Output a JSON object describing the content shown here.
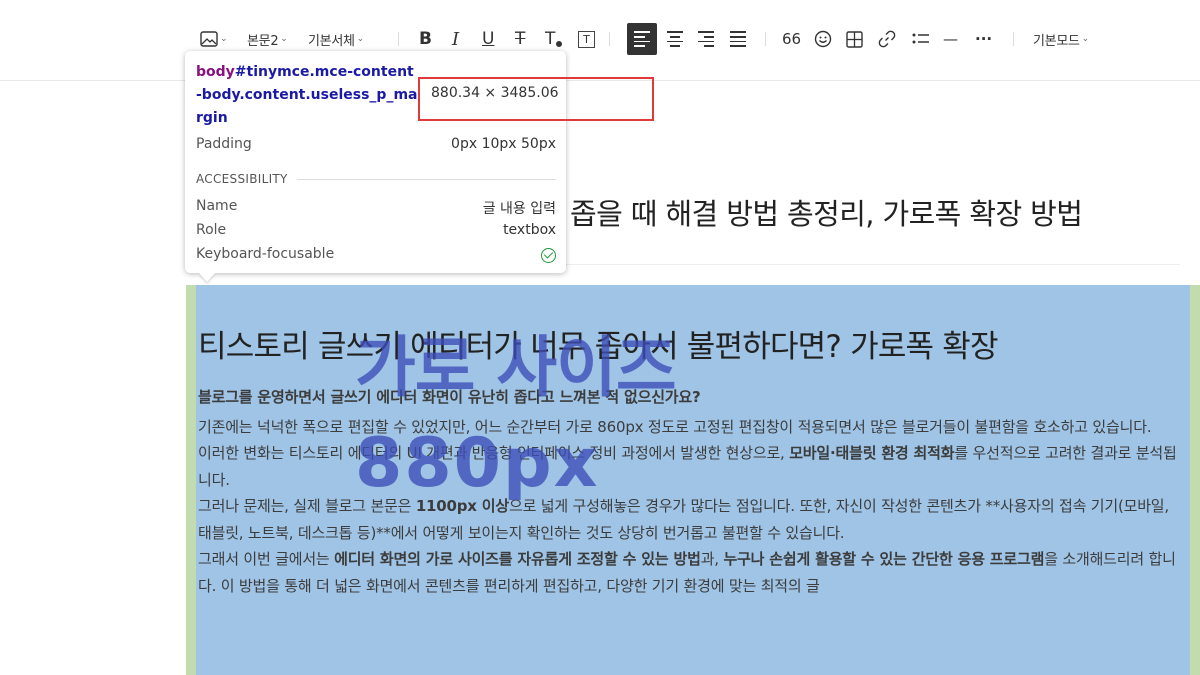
{
  "toolbar": {
    "image_icon": "image-icon",
    "paragraph_style": "본문2",
    "font_family": "기본서체",
    "bold": "B",
    "italic": "I",
    "underline": "U",
    "strike": "T",
    "text_color": "T",
    "text_bg": "T",
    "quote": "66",
    "emoji_icon": "emoji-icon",
    "table_icon": "table-icon",
    "link_icon": "link-icon",
    "list_icon": "list-icon",
    "divider": "—",
    "more": "···",
    "mode": "기본모드"
  },
  "post": {
    "title": "좁을 때 해결 방법 총정리, 가로폭 확장 방법",
    "heading": "티스토리 글쓰기 에디터가 너무 좁아서 불편하다면? 가로폭 확장",
    "lead": "블로그를 운영하면서 글쓰기 에디터 화면이 유난히 좁다고 느껴본 적 없으신가요?",
    "p1": "기존에는 넉넉한 폭으로 편집할 수 있었지만, 어느 순간부터 가로 860px 정도로 고정된 편집창이 적용되면서 많은 블로거들이 불편함을 호소하고 있습니다.",
    "p2_a": "이러한 변화는 티스토리 에디터의 UI 개편과 반응형 인터페이스 정비 과정에서 발생한 현상으로, ",
    "p2_b": "모바일·태블릿 환경 최적화",
    "p2_c": "를 우선적으로 고려한 결과로 분석됩니다.",
    "p3_a": "그러나 문제는, 실제 블로그 본문은 ",
    "p3_b": "1100px 이상",
    "p3_c": "으로 넓게 구성해놓은 경우가 많다는 점입니다. 또한, 자신이 작성한 콘텐츠가 **사용자의 접속 기기(모바일, 태블릿, 노트북, 데스크톱 등)**에서 어떻게 보이는지 확인하는 것도 상당히 번거롭고 불편할 수 있습니다.",
    "p4_a": "그래서 이번 글에서는 ",
    "p4_b": "에디터 화면의 가로 사이즈를 자유롭게 조정할 수 있는 방법",
    "p4_c": "과, ",
    "p4_d": "누구나 손쉽게 활용할 수 있는 간단한 응용 프로그램",
    "p4_e": "을 소개해드리려 합니다. 이 방법을 통해 더 넓은 화면에서 콘텐츠를 편리하게 편집하고, 다양한 기기 환경에 맞는 최적의 글"
  },
  "overlay": {
    "line1": "가로 사이즈",
    "line2": "880px"
  },
  "tooltip": {
    "selector_tag": "body",
    "selector_rest": "#tinymce.mce-content-body.content.useless_p_margin",
    "dimensions": "880.34 × 3485.06",
    "padding_label": "Padding",
    "padding_value": "0px 10px 50px",
    "accessibility_header": "ACCESSIBILITY",
    "name_label": "Name",
    "name_value": "글 내용 입력",
    "role_label": "Role",
    "role_value": "textbox",
    "focusable_label": "Keyboard-focusable",
    "focusable_icon": "check-circle-icon"
  },
  "colors": {
    "highlight_content": "#9fc4e6",
    "highlight_padding": "#c2dcb0",
    "overlay_text": "#3d4db8",
    "callout_border": "#e23a3a"
  }
}
